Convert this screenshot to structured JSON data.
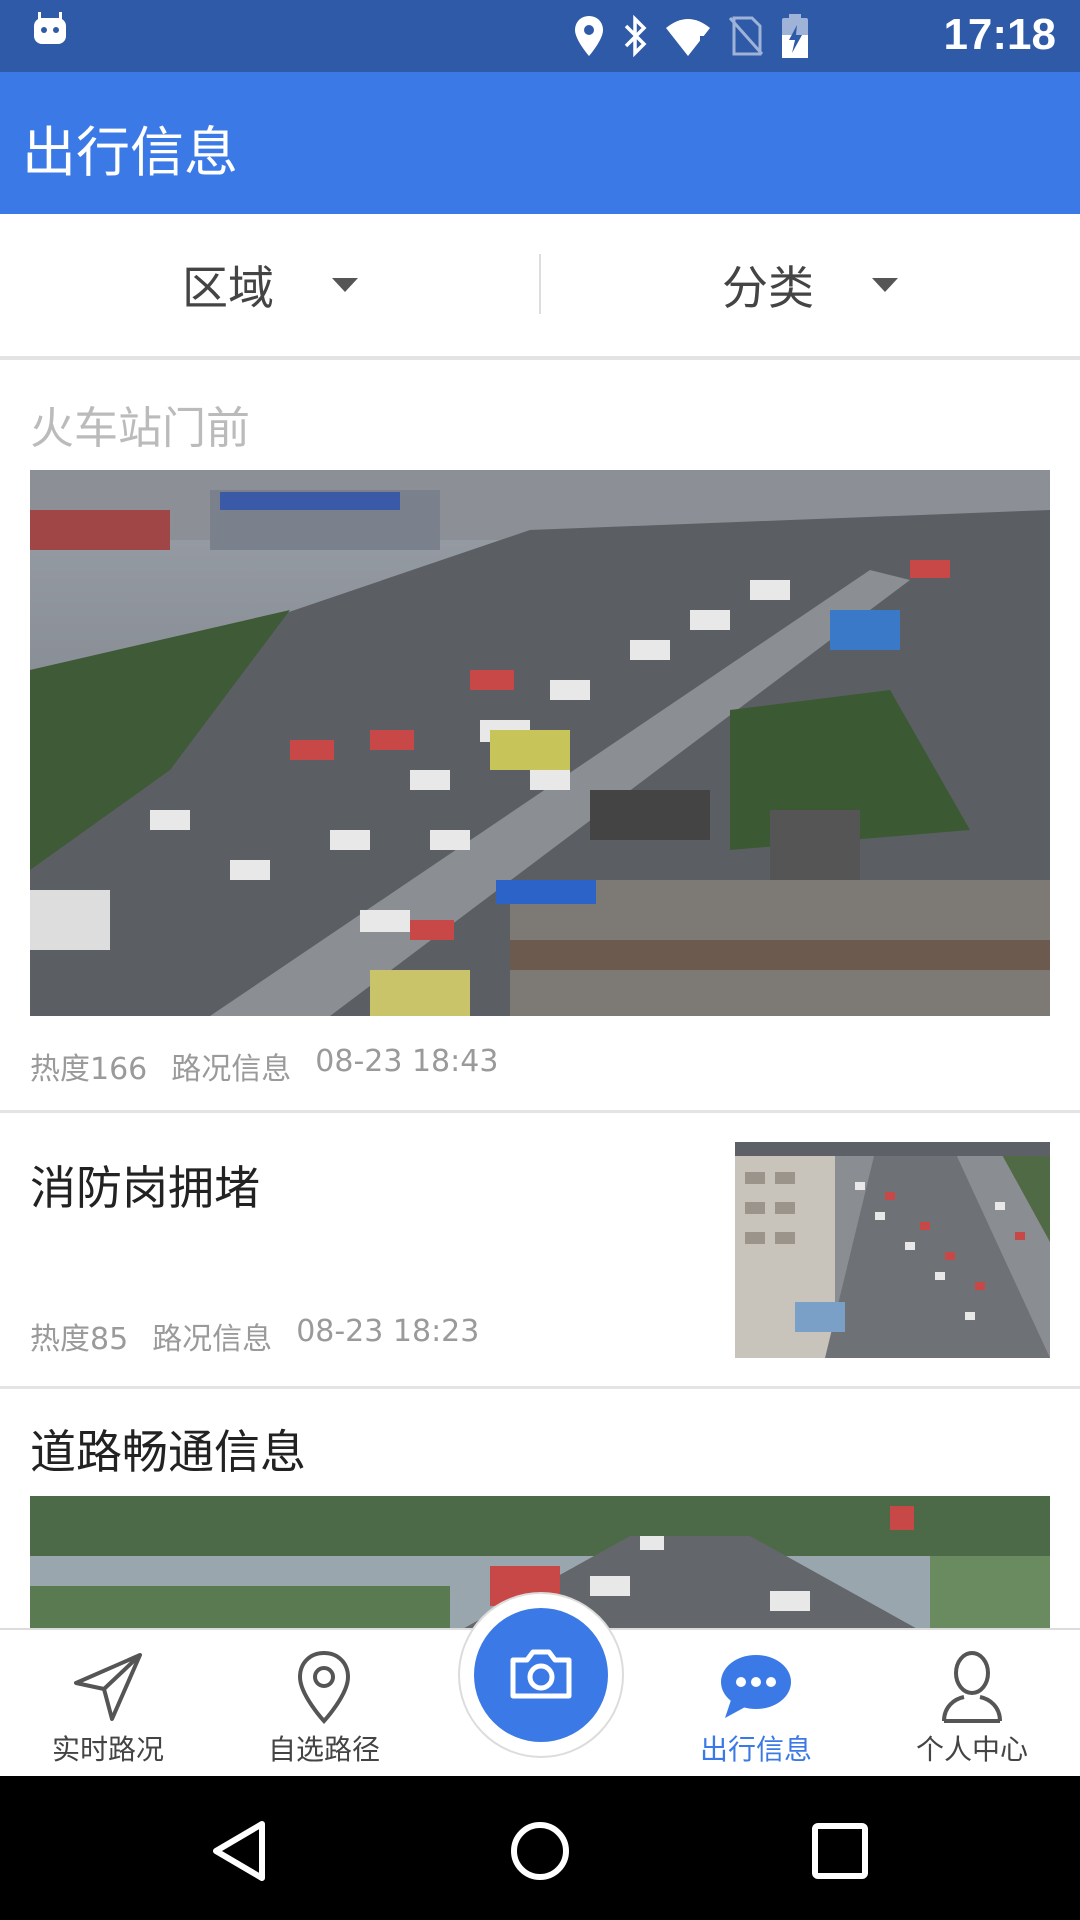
{
  "status_bar": {
    "time": "17:18"
  },
  "app_bar": {
    "title": "出行信息"
  },
  "filters": {
    "region_label": "区域",
    "category_label": "分类"
  },
  "feed": {
    "items": [
      {
        "title": "火车站门前",
        "heat": "热度166",
        "type": "路况信息",
        "time": "08-23 18:43"
      },
      {
        "title": "消防岗拥堵",
        "heat": "热度85",
        "type": "路况信息",
        "time": "08-23 18:23"
      },
      {
        "title": "道路畅通信息"
      }
    ]
  },
  "bottom_nav": {
    "items": [
      {
        "label": "实时路况",
        "icon": "navigation-arrow-icon"
      },
      {
        "label": "自选路径",
        "icon": "map-pin-icon"
      },
      {
        "label": "",
        "icon": "camera-icon"
      },
      {
        "label": "出行信息",
        "icon": "chat-bubble-icon",
        "active": true
      },
      {
        "label": "个人中心",
        "icon": "person-icon"
      }
    ]
  },
  "colors": {
    "primary": "#3b7ae6",
    "status_bar": "#2f5aa8",
    "meta_text": "#9a9a9a"
  }
}
